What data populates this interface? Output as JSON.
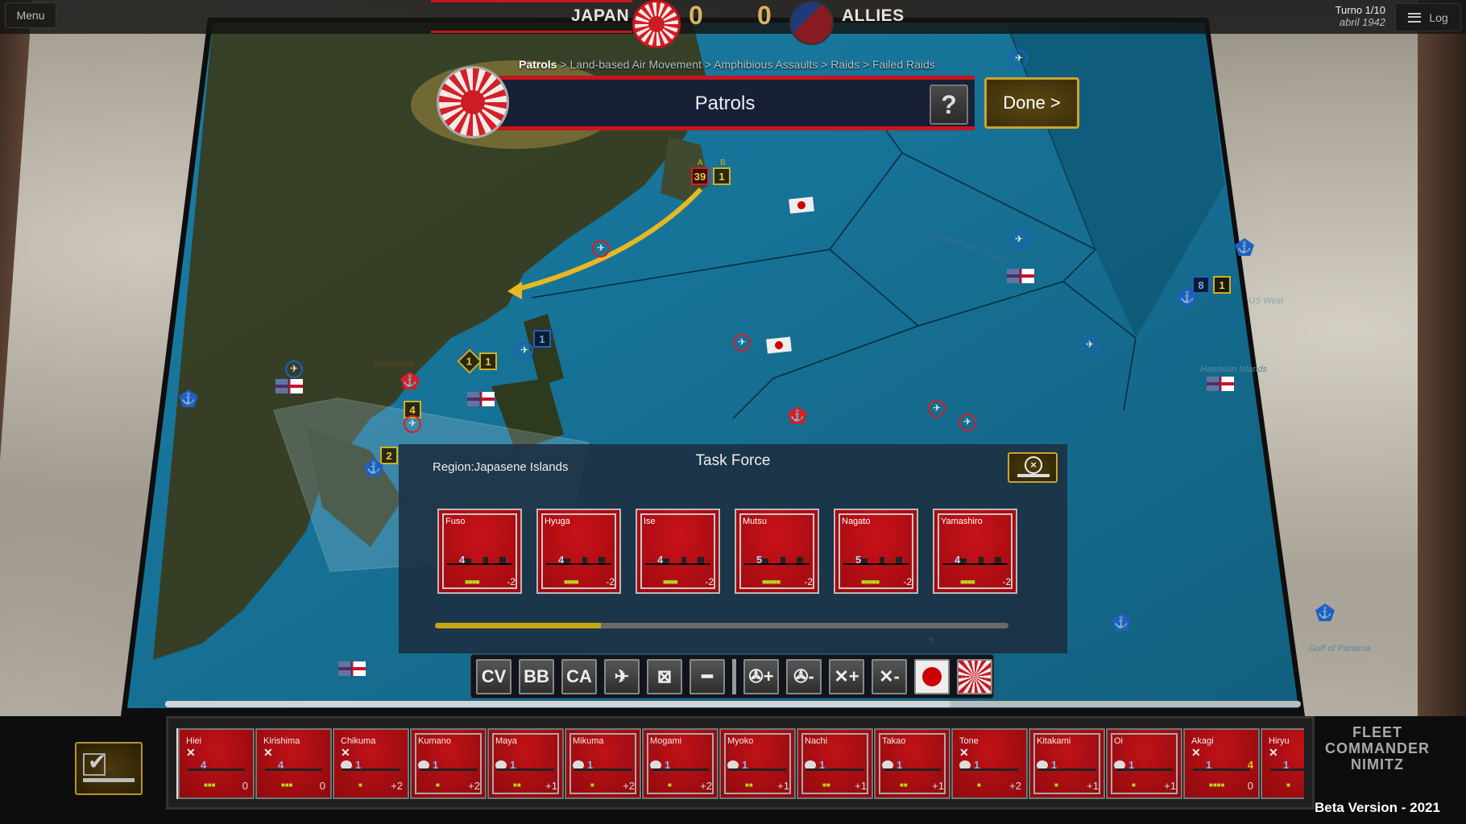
{
  "topbar": {
    "menu_label": "Menu",
    "log_label": "Log",
    "turn_label": "Turno 1/10",
    "date_label": "abril 1942"
  },
  "score": {
    "left_faction": "JAPAN",
    "left_score": "0",
    "right_faction": "ALLIES",
    "right_score": "0"
  },
  "phase": {
    "breadcrumb": [
      {
        "label": "Patrols",
        "current": true
      },
      {
        "label": "Land-based Air Movement",
        "current": false
      },
      {
        "label": "Amphibious Assaults",
        "current": false
      },
      {
        "label": "Raids",
        "current": false
      },
      {
        "label": "Failed Raids",
        "current": false
      }
    ],
    "separator": " > ",
    "title": "Patrols",
    "help_label": "?",
    "done_label": "Done >"
  },
  "map": {
    "region_labels": [
      "Central Pacific Ocean",
      "US West Coast",
      "Hawaiian Islands",
      "Gulf of Panama",
      "Indochina",
      "Panama",
      "US West"
    ],
    "markers": [
      {
        "id": "japan-a",
        "side": "japan",
        "group": "A",
        "count": "39"
      },
      {
        "id": "japan-b",
        "side": "japan",
        "group": "B",
        "count": "1"
      },
      {
        "id": "china-sea-a",
        "side": "japan",
        "group": "A",
        "count": "1"
      },
      {
        "id": "china-sea-b",
        "side": "japan",
        "group": "B",
        "count": "1"
      },
      {
        "id": "philippines-a",
        "side": "allies",
        "group": "A",
        "count": "1"
      },
      {
        "id": "indochina-a",
        "side": "japan",
        "group": "A",
        "count": "4"
      },
      {
        "id": "malaya-a",
        "side": "japan",
        "group": "A",
        "count": "2"
      },
      {
        "id": "hawaii-a",
        "side": "allies",
        "group": "A",
        "count": "8"
      },
      {
        "id": "hawaii-b",
        "side": "allies",
        "group": "B",
        "count": "1"
      }
    ]
  },
  "task_force": {
    "title": "Task Force",
    "region_label": "Region:",
    "region_value": "Japasene Islands",
    "progress": 0.29,
    "ships": [
      {
        "name": "Fuso",
        "gun": "4",
        "pips": "■■■■",
        "mod": "-2"
      },
      {
        "name": "Hyuga",
        "gun": "4",
        "pips": "■■■■",
        "mod": "-2"
      },
      {
        "name": "Ise",
        "gun": "4",
        "pips": "■■■■",
        "mod": "-2"
      },
      {
        "name": "Mutsu",
        "gun": "5",
        "pips": "■■■■■",
        "mod": "-2"
      },
      {
        "name": "Nagato",
        "gun": "5",
        "pips": "■■■■■",
        "mod": "-2"
      },
      {
        "name": "Yamashiro",
        "gun": "4",
        "pips": "■■■■",
        "mod": "-2"
      }
    ]
  },
  "filters": [
    {
      "id": "cv",
      "label": "CV",
      "icon": "carrier-icon"
    },
    {
      "id": "bb",
      "label": "BB",
      "icon": "battleship-icon"
    },
    {
      "id": "ca",
      "label": "CA",
      "icon": "cruiser-icon"
    },
    {
      "id": "air",
      "label": "✈",
      "icon": "aircraft-icon"
    },
    {
      "id": "army",
      "label": "⊠",
      "icon": "army-icon"
    },
    {
      "id": "sub",
      "label": "━",
      "icon": "submarine-icon"
    },
    {
      "id": "prop-plus",
      "label": "✇+",
      "icon": "propeller-plus-icon"
    },
    {
      "id": "prop-minus",
      "label": "✇-",
      "icon": "propeller-minus-icon"
    },
    {
      "id": "repair-plus",
      "label": "✕+",
      "icon": "repair-plus-icon"
    },
    {
      "id": "repair-minus",
      "label": "✕-",
      "icon": "repair-minus-icon"
    },
    {
      "id": "japan",
      "label": "",
      "icon": "japan-flag-icon"
    },
    {
      "id": "navy",
      "label": "",
      "icon": "rising-sun-flag-icon"
    }
  ],
  "tray": {
    "confirm_icon": "confirm-ships-icon",
    "cards": [
      {
        "name": "Hiei",
        "repair": true,
        "weapon": "gun",
        "gun": "4",
        "pips": "■■■",
        "mod": "0",
        "framed": false
      },
      {
        "name": "Kirishima",
        "repair": true,
        "weapon": "gun",
        "gun": "4",
        "pips": "■■■",
        "mod": "0",
        "framed": false
      },
      {
        "name": "Chikuma",
        "repair": true,
        "weapon": "torpedo",
        "gun": "1",
        "pips": "■",
        "mod": "+2",
        "framed": false
      },
      {
        "name": "Kumano",
        "repair": false,
        "weapon": "torpedo",
        "gun": "1",
        "pips": "■",
        "mod": "+2",
        "framed": true
      },
      {
        "name": "Maya",
        "repair": false,
        "weapon": "torpedo",
        "gun": "1",
        "pips": "■■",
        "mod": "+1",
        "framed": true
      },
      {
        "name": "Mikuma",
        "repair": false,
        "weapon": "torpedo",
        "gun": "1",
        "pips": "■",
        "mod": "+2",
        "framed": true
      },
      {
        "name": "Mogami",
        "repair": false,
        "weapon": "torpedo",
        "gun": "1",
        "pips": "■",
        "mod": "+2",
        "framed": true
      },
      {
        "name": "Myoko",
        "repair": false,
        "weapon": "torpedo",
        "gun": "1",
        "pips": "■■",
        "mod": "+1",
        "framed": true
      },
      {
        "name": "Nachi",
        "repair": false,
        "weapon": "torpedo",
        "gun": "1",
        "pips": "■■",
        "mod": "+1",
        "framed": true
      },
      {
        "name": "Takao",
        "repair": false,
        "weapon": "torpedo",
        "gun": "1",
        "pips": "■■",
        "mod": "+1",
        "framed": true
      },
      {
        "name": "Tone",
        "repair": true,
        "weapon": "torpedo",
        "gun": "1",
        "pips": "■",
        "mod": "+2",
        "framed": false
      },
      {
        "name": "Kitakami",
        "repair": false,
        "weapon": "torpedo",
        "gun": "1",
        "pips": "■",
        "mod": "+1",
        "framed": true
      },
      {
        "name": "Oi",
        "repair": false,
        "weapon": "torpedo",
        "gun": "1",
        "pips": "■",
        "mod": "+1",
        "framed": true
      },
      {
        "name": "Akagi",
        "repair": true,
        "weapon": "gun",
        "gun": "1",
        "air": "4",
        "pips": "■■■■",
        "mod": "0",
        "framed": false
      },
      {
        "name": "Hiryu",
        "repair": true,
        "weapon": "gun",
        "gun": "1",
        "pips": "■",
        "mod": "",
        "framed": false
      }
    ]
  },
  "branding": {
    "logo_text": "FLEET COMMANDER NIMITZ",
    "version": "Beta Version - 2021"
  },
  "colors": {
    "japan_red": "#c9151b",
    "gold": "#c9a52c",
    "allied_blue": "#1f5fc4",
    "ocean": "#1b8ab0"
  }
}
